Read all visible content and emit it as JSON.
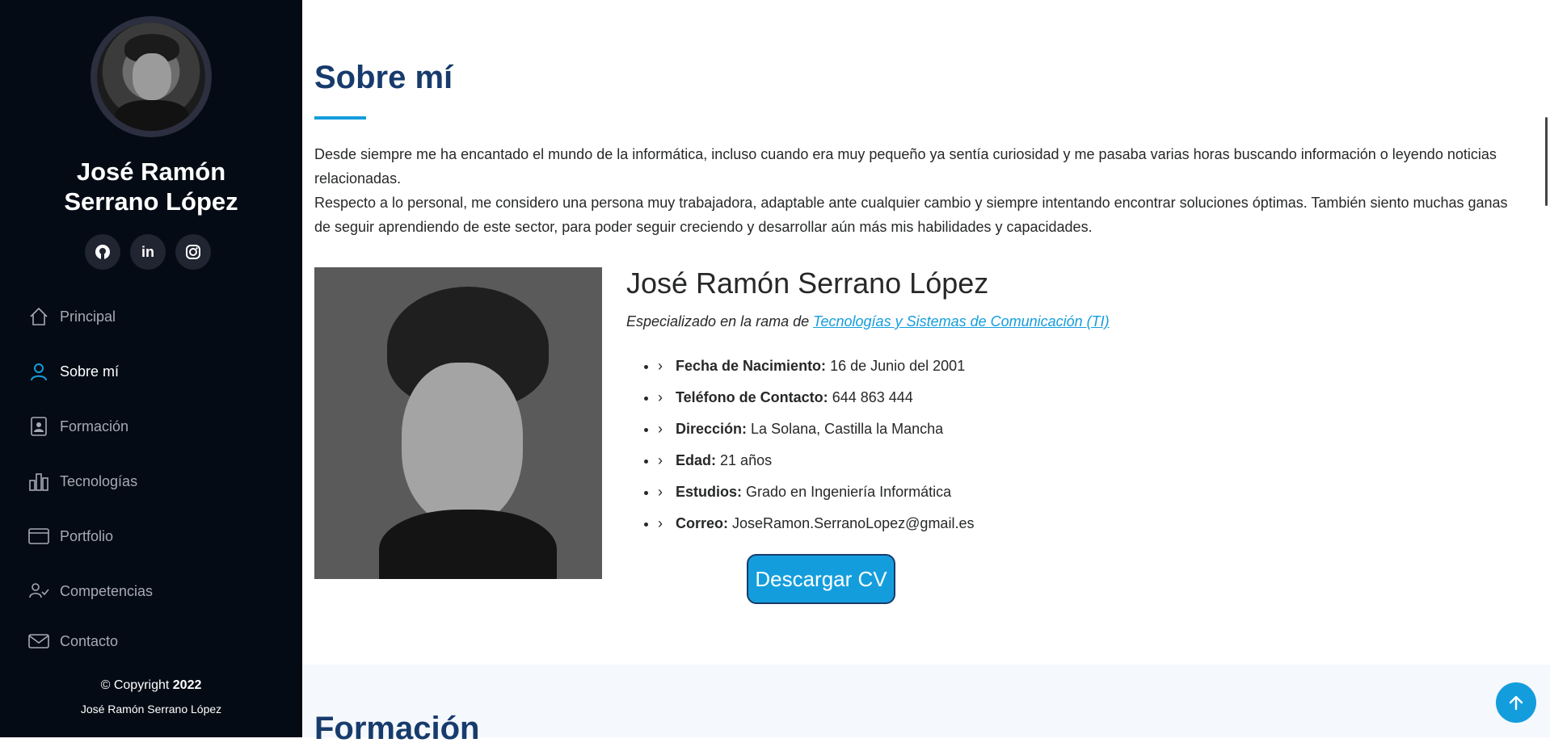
{
  "sidebar": {
    "name": "José Ramón Serrano López",
    "social": [
      {
        "icon": "github-icon",
        "glyph": "●"
      },
      {
        "icon": "linkedin-icon",
        "glyph": "in"
      },
      {
        "icon": "instagram-icon",
        "glyph": "◎"
      }
    ],
    "nav": [
      {
        "label": "Principal",
        "icon": "home-icon",
        "active": false
      },
      {
        "label": "Sobre mí",
        "icon": "user-icon",
        "active": true
      },
      {
        "label": "Formación",
        "icon": "file-person-icon",
        "active": false
      },
      {
        "label": "Tecnologías",
        "icon": "bar-chart-icon",
        "active": false
      },
      {
        "label": "Portfolio",
        "icon": "window-icon",
        "active": false
      },
      {
        "label": "Competencias",
        "icon": "person-check-icon",
        "active": false
      },
      {
        "label": "Contacto",
        "icon": "envelope-icon",
        "active": false
      }
    ],
    "copyright_prefix": "© Copyright",
    "copyright_year": "2022",
    "copyright_author": "José Ramón Serrano López"
  },
  "about": {
    "title": "Sobre mí",
    "intro_1": "Desde siempre me ha encantado el mundo de la informática, incluso cuando era muy pequeño ya sentía curiosidad y me pasaba varias horas buscando información o leyendo noticias relacionadas.",
    "intro_2": "Respecto a lo personal, me considero una persona muy trabajadora, adaptable ante cualquier cambio y siempre intentando encontrar soluciones óptimas. También siento muchas ganas de seguir aprendiendo de este sector, para poder seguir creciendo y desarrollar aún más mis habilidades y capacidades.",
    "profile_name": "José Ramón Serrano López",
    "spec_prefix": "Especializado en la rama de",
    "spec_link": "Tecnologías y Sistemas de Comunicación (TI)",
    "details": [
      {
        "label": "Fecha de Nacimiento:",
        "value": "16 de Junio del 2001"
      },
      {
        "label": "Teléfono de Contacto:",
        "value": "644 863 444"
      },
      {
        "label": "Dirección:",
        "value": "La Solana, Castilla la Mancha"
      },
      {
        "label": "Edad:",
        "value": "21 años"
      },
      {
        "label": "Estudios:",
        "value": "Grado en Ingeniería Informática"
      },
      {
        "label": "Correo:",
        "value": "JoseRamon.SerranoLopez@gmail.es"
      }
    ],
    "cv_button": "Descargar CV"
  },
  "next_section": {
    "title": "Formación"
  },
  "colors": {
    "sidebar_bg": "#040b14",
    "accent": "#149ddd",
    "heading": "#173b6c"
  }
}
